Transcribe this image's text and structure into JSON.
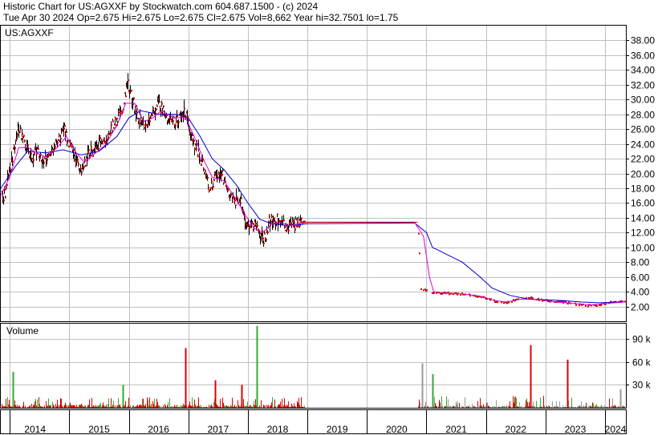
{
  "header": {
    "line1": "Historic Chart for US:AGXXF by Stockwatch.com 604.687.1500 - (c) 2024",
    "line2": "Tue Apr 30 2024   Op=2.675   Hi=2.675   Lo=2.675   Cl=2.675   Vol=8,662   Year hi=32.7501   lo=1.75"
  },
  "colors": {
    "price": "#cc0000",
    "bar": "#000000",
    "ma_short": "#dd00dd",
    "ma_long": "#0000cc",
    "vol_up": "#33aa33",
    "vol_down": "#dd0000",
    "vol_flat": "#999999",
    "grid": "#c0c0c0",
    "frame": "#000000"
  },
  "chart_data": [
    {
      "type": "line",
      "ticker_label": "US:AGXXF",
      "ylim": [
        0,
        40
      ],
      "yticks": [
        "2.00",
        "4.00",
        "6.00",
        "8.00",
        "10.00",
        "12.00",
        "14.00",
        "16.00",
        "18.00",
        "20.00",
        "22.00",
        "24.00",
        "26.00",
        "28.00",
        "30.00",
        "32.00",
        "34.00",
        "36.00",
        "38.00"
      ],
      "ytick_values": [
        2,
        4,
        6,
        8,
        10,
        12,
        14,
        16,
        18,
        20,
        22,
        24,
        26,
        28,
        30,
        32,
        34,
        36,
        38
      ],
      "xlim": [
        2013.85,
        2024.35
      ],
      "x_ticks": [
        {
          "label": "2014",
          "x": 2014
        },
        {
          "label": "2015",
          "x": 2015
        },
        {
          "label": "2016",
          "x": 2016
        },
        {
          "label": "2017",
          "x": 2017
        },
        {
          "label": "2018",
          "x": 2018
        },
        {
          "label": "2019",
          "x": 2019
        },
        {
          "label": "2020",
          "x": 2020
        },
        {
          "label": "2021",
          "x": 2021
        },
        {
          "label": "2022",
          "x": 2022
        },
        {
          "label": "2023",
          "x": 2023
        },
        {
          "label": "2024",
          "x": 2024
        }
      ],
      "series": [
        {
          "role": "price",
          "points": [
            [
              2013.85,
              16.5
            ],
            [
              2013.92,
              17.5
            ],
            [
              2014.0,
              20.5
            ],
            [
              2014.08,
              24.0
            ],
            [
              2014.15,
              25.8
            ],
            [
              2014.22,
              24.5
            ],
            [
              2014.3,
              23.0
            ],
            [
              2014.38,
              22.0
            ],
            [
              2014.45,
              23.5
            ],
            [
              2014.52,
              22.0
            ],
            [
              2014.6,
              21.8
            ],
            [
              2014.7,
              23.0
            ],
            [
              2014.8,
              24.5
            ],
            [
              2014.9,
              26.0
            ],
            [
              2015.0,
              24.0
            ],
            [
              2015.1,
              22.0
            ],
            [
              2015.2,
              20.5
            ],
            [
              2015.3,
              22.5
            ],
            [
              2015.4,
              23.0
            ],
            [
              2015.5,
              24.5
            ],
            [
              2015.6,
              24.0
            ],
            [
              2015.7,
              26.0
            ],
            [
              2015.8,
              27.5
            ],
            [
              2015.9,
              29.0
            ],
            [
              2015.97,
              32.0
            ],
            [
              2016.05,
              30.5
            ],
            [
              2016.12,
              28.0
            ],
            [
              2016.2,
              27.0
            ],
            [
              2016.3,
              26.0
            ],
            [
              2016.4,
              28.5
            ],
            [
              2016.5,
              29.5
            ],
            [
              2016.6,
              28.0
            ],
            [
              2016.7,
              27.5
            ],
            [
              2016.8,
              27.0
            ],
            [
              2016.9,
              28.5
            ],
            [
              2016.97,
              27.5
            ],
            [
              2017.05,
              25.0
            ],
            [
              2017.15,
              23.0
            ],
            [
              2017.25,
              21.0
            ],
            [
              2017.35,
              18.0
            ],
            [
              2017.45,
              19.5
            ],
            [
              2017.55,
              20.5
            ],
            [
              2017.65,
              17.5
            ],
            [
              2017.75,
              16.0
            ],
            [
              2017.85,
              17.0
            ],
            [
              2017.93,
              14.5
            ],
            [
              2018.0,
              12.5
            ],
            [
              2018.1,
              13.0
            ],
            [
              2018.2,
              11.8
            ],
            [
              2018.28,
              11.0
            ],
            [
              2018.35,
              13.5
            ],
            [
              2018.45,
              14.0
            ],
            [
              2018.55,
              13.5
            ],
            [
              2018.63,
              12.5
            ],
            [
              2018.7,
              13.0
            ],
            [
              2018.8,
              13.0
            ],
            [
              2018.87,
              13.4
            ],
            [
              2020.85,
              13.4
            ],
            [
              2020.9,
              4.2
            ],
            [
              2021.0,
              4.2
            ],
            [
              2021.1,
              3.8
            ],
            [
              2021.3,
              3.8
            ],
            [
              2021.5,
              3.7
            ],
            [
              2021.7,
              3.6
            ],
            [
              2021.9,
              3.3
            ],
            [
              2022.1,
              2.8
            ],
            [
              2022.3,
              2.4
            ],
            [
              2022.5,
              2.9
            ],
            [
              2022.7,
              3.2
            ],
            [
              2022.9,
              2.9
            ],
            [
              2023.1,
              2.7
            ],
            [
              2023.3,
              2.6
            ],
            [
              2023.5,
              2.3
            ],
            [
              2023.7,
              2.1
            ],
            [
              2023.9,
              2.2
            ],
            [
              2024.05,
              2.5
            ],
            [
              2024.2,
              2.7
            ],
            [
              2024.33,
              2.675
            ]
          ]
        },
        {
          "role": "ma_short",
          "points": [
            [
              2013.85,
              17.0
            ],
            [
              2014.0,
              19.5
            ],
            [
              2014.15,
              23.5
            ],
            [
              2014.3,
              23.5
            ],
            [
              2014.45,
              22.8
            ],
            [
              2014.6,
              22.2
            ],
            [
              2014.8,
              23.5
            ],
            [
              2014.95,
              25.0
            ],
            [
              2015.1,
              23.0
            ],
            [
              2015.25,
              21.5
            ],
            [
              2015.4,
              22.5
            ],
            [
              2015.6,
              23.8
            ],
            [
              2015.8,
              26.5
            ],
            [
              2015.95,
              29.5
            ],
            [
              2016.1,
              29.5
            ],
            [
              2016.25,
              27.0
            ],
            [
              2016.4,
              27.5
            ],
            [
              2016.55,
              28.5
            ],
            [
              2016.75,
              27.5
            ],
            [
              2016.95,
              27.6
            ],
            [
              2017.1,
              25.0
            ],
            [
              2017.25,
              22.0
            ],
            [
              2017.4,
              19.5
            ],
            [
              2017.6,
              19.0
            ],
            [
              2017.8,
              16.5
            ],
            [
              2017.95,
              14.5
            ],
            [
              2018.1,
              12.6
            ],
            [
              2018.25,
              12.0
            ],
            [
              2018.4,
              13.2
            ],
            [
              2018.55,
              13.4
            ],
            [
              2018.7,
              12.9
            ],
            [
              2018.85,
              13.2
            ],
            [
              2019.0,
              13.4
            ],
            [
              2020.8,
              13.4
            ],
            [
              2020.95,
              11.5
            ],
            [
              2021.05,
              6.0
            ],
            [
              2021.12,
              4.0
            ],
            [
              2021.3,
              3.8
            ],
            [
              2021.6,
              3.7
            ],
            [
              2021.9,
              3.4
            ],
            [
              2022.15,
              2.8
            ],
            [
              2022.35,
              2.6
            ],
            [
              2022.6,
              3.0
            ],
            [
              2022.9,
              2.9
            ],
            [
              2023.2,
              2.6
            ],
            [
              2023.5,
              2.4
            ],
            [
              2023.75,
              2.2
            ],
            [
              2024.0,
              2.4
            ],
            [
              2024.33,
              2.6
            ]
          ]
        },
        {
          "role": "ma_long",
          "points": [
            [
              2013.85,
              18.0
            ],
            [
              2014.1,
              21.0
            ],
            [
              2014.3,
              23.0
            ],
            [
              2014.6,
              22.8
            ],
            [
              2014.9,
              23.2
            ],
            [
              2015.2,
              22.5
            ],
            [
              2015.5,
              23.0
            ],
            [
              2015.8,
              25.0
            ],
            [
              2016.0,
              27.5
            ],
            [
              2016.2,
              28.5
            ],
            [
              2016.5,
              28.0
            ],
            [
              2016.8,
              28.0
            ],
            [
              2017.0,
              27.5
            ],
            [
              2017.2,
              25.0
            ],
            [
              2017.4,
              22.0
            ],
            [
              2017.6,
              20.5
            ],
            [
              2017.8,
              18.5
            ],
            [
              2018.0,
              16.0
            ],
            [
              2018.2,
              13.8
            ],
            [
              2018.4,
              13.2
            ],
            [
              2018.6,
              13.0
            ],
            [
              2018.8,
              13.0
            ],
            [
              2019.0,
              13.2
            ],
            [
              2020.8,
              13.3
            ],
            [
              2021.0,
              12.0
            ],
            [
              2021.1,
              10.0
            ],
            [
              2021.3,
              9.2
            ],
            [
              2021.6,
              8.0
            ],
            [
              2021.9,
              6.0
            ],
            [
              2022.1,
              4.5
            ],
            [
              2022.4,
              3.5
            ],
            [
              2022.7,
              3.0
            ],
            [
              2023.0,
              2.9
            ],
            [
              2023.3,
              2.8
            ],
            [
              2023.6,
              2.6
            ],
            [
              2023.9,
              2.5
            ],
            [
              2024.33,
              2.6
            ]
          ]
        }
      ]
    },
    {
      "type": "bar",
      "title": "Volume",
      "ylim": [
        0,
        110000
      ],
      "yticks": [
        "30 k",
        "60 k",
        "90 k"
      ],
      "ytick_values": [
        30000,
        60000,
        90000
      ],
      "spikes": [
        {
          "x": 2014.05,
          "value": 47000,
          "dir": "up"
        },
        {
          "x": 2015.9,
          "value": 30000,
          "dir": "up"
        },
        {
          "x": 2016.95,
          "value": 78000,
          "dir": "down"
        },
        {
          "x": 2017.45,
          "value": 36000,
          "dir": "down"
        },
        {
          "x": 2017.9,
          "value": 30000,
          "dir": "down"
        },
        {
          "x": 2018.15,
          "value": 107000,
          "dir": "up"
        },
        {
          "x": 2020.93,
          "value": 58000,
          "dir": "flat"
        },
        {
          "x": 2021.1,
          "value": 44000,
          "dir": "up"
        },
        {
          "x": 2022.75,
          "value": 82000,
          "dir": "down"
        },
        {
          "x": 2023.37,
          "value": 63000,
          "dir": "down"
        },
        {
          "x": 2024.25,
          "value": 24000,
          "dir": "flat"
        }
      ]
    }
  ]
}
